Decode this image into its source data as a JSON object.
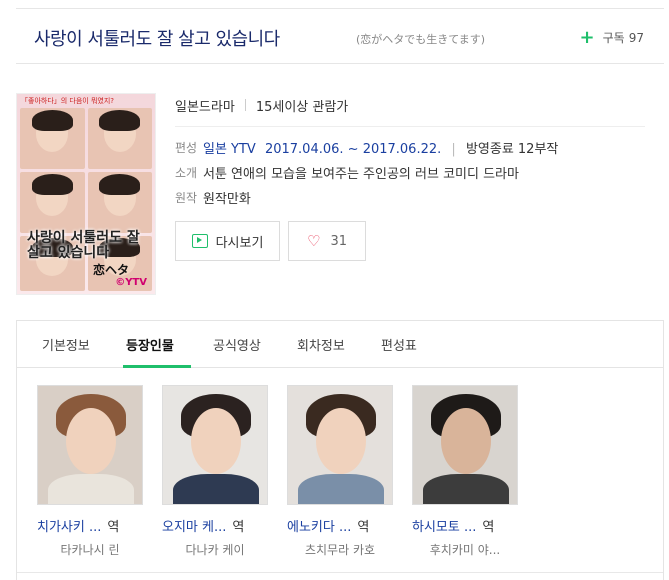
{
  "header": {
    "title": "사랑이 서툴러도 잘 살고 있습니다",
    "subtitle": "(恋がヘタでも生きてます)",
    "subscribe_label": "구독",
    "subscribe_count": "97"
  },
  "poster": {
    "top_text": "「좋아하다」의 다음이 뭐였지?",
    "title": "사랑이 서툴러도 잘살고 있습니다",
    "kanji": "恋ヘタ",
    "logo": "©YTV"
  },
  "info": {
    "tags": [
      "일본드라마",
      "15세이상 관람가"
    ],
    "rows": [
      {
        "label": "편성",
        "channel": "일본 YTV",
        "period": "2017.04.06. ~ 2017.06.22.",
        "status": "방영종료 12부작"
      },
      {
        "label": "소개",
        "value": "서툰 연애의 모습을 보여주는 주인공의 러브 코미디 드라마"
      },
      {
        "label": "원작",
        "value": "원작만화"
      }
    ],
    "replay_label": "다시보기",
    "like_count": "31"
  },
  "tabs": [
    {
      "label": "기본정보",
      "active": false
    },
    {
      "label": "등장인물",
      "active": true
    },
    {
      "label": "공식영상",
      "active": false
    },
    {
      "label": "회차정보",
      "active": false
    },
    {
      "label": "편성표",
      "active": false
    }
  ],
  "cast": [
    {
      "name": "치가사키 ...",
      "role": "역",
      "actor": "타카나시 린",
      "hair": "#8a5a3c",
      "clothes": "#e9e4dc"
    },
    {
      "name": "오지마 케...",
      "role": "역",
      "actor": "다나카 케이",
      "hair": "#2b2220",
      "clothes": "#2e3a52"
    },
    {
      "name": "에노키다 ...",
      "role": "역",
      "actor": "츠치무라 카호",
      "hair": "#3a2a20",
      "clothes": "#7a8fa8"
    },
    {
      "name": "하시모토 ...",
      "role": "역",
      "actor": "후치카미 야...",
      "hair": "#1e1a18",
      "clothes": "#3c3c3c"
    }
  ],
  "colors": {
    "accent": "#1fbf6b",
    "title": "#1a2a6b",
    "link": "#1a3fa0"
  }
}
